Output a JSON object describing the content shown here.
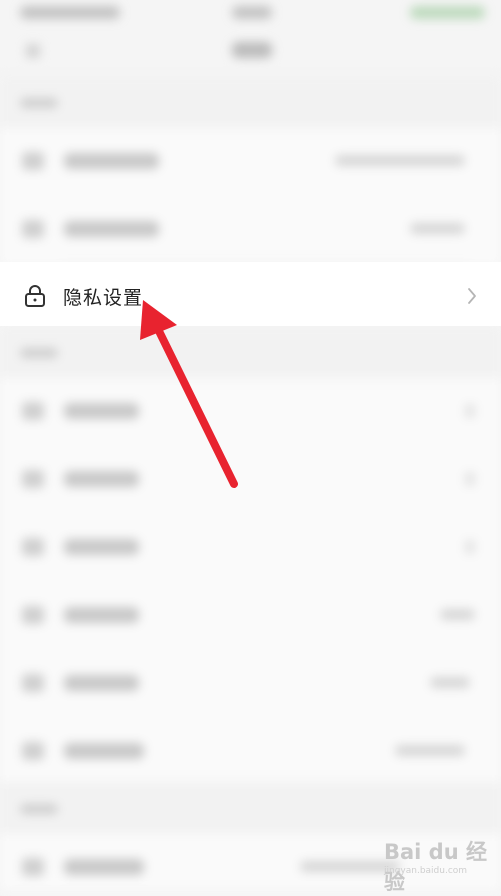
{
  "privacy_row": {
    "label": "隐私设置",
    "icon": "lock-icon",
    "chevron": "chevron-right-icon"
  },
  "annotation": {
    "color": "#e8232f"
  },
  "watermark": {
    "brand": "Bai du 经验",
    "sub": "jingyan.baidu.com"
  }
}
